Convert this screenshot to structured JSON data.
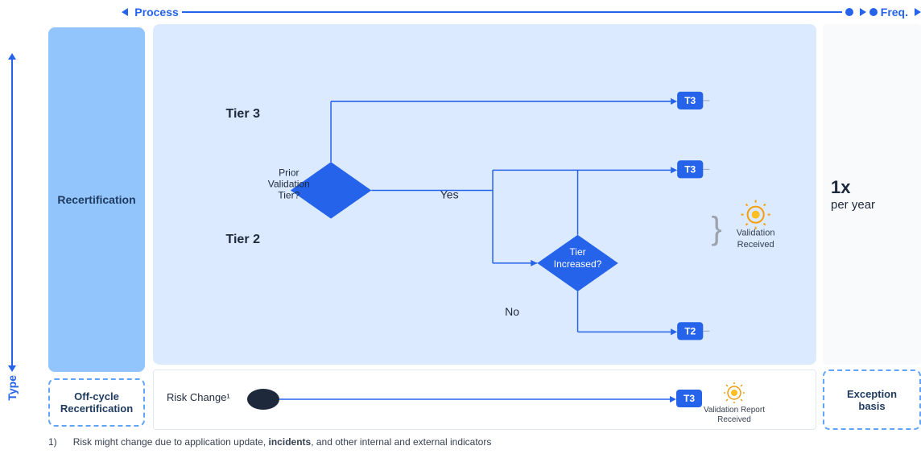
{
  "header": {
    "process_label": "Process",
    "freq_label": "Freq."
  },
  "type_label": "Type",
  "left_panel": {
    "recertification": "Recertification",
    "off_cycle": "Off-cycle\nRecertification"
  },
  "diagram": {
    "tier3_label": "Tier 3",
    "tier2_label": "Tier 2",
    "prior_validation": "Prior\nValidation\nTier?",
    "tier_increased": "Tier\nIncreased?",
    "yes_label": "Yes",
    "no_label": "No",
    "t3_badge": "T3",
    "t2_badge": "T2",
    "validation_received": "Validation\nReceived",
    "risk_change": "Risk Change¹",
    "validation_report": "Validation Report\nReceived"
  },
  "freq": {
    "value": "1x",
    "per_year": "per year",
    "exception": "Exception\nbasis"
  },
  "footnote": {
    "number": "1)",
    "text_before": "Risk might change due to application update, ",
    "bold_text": "incidents",
    "text_after": ", and other internal and external indicators"
  }
}
